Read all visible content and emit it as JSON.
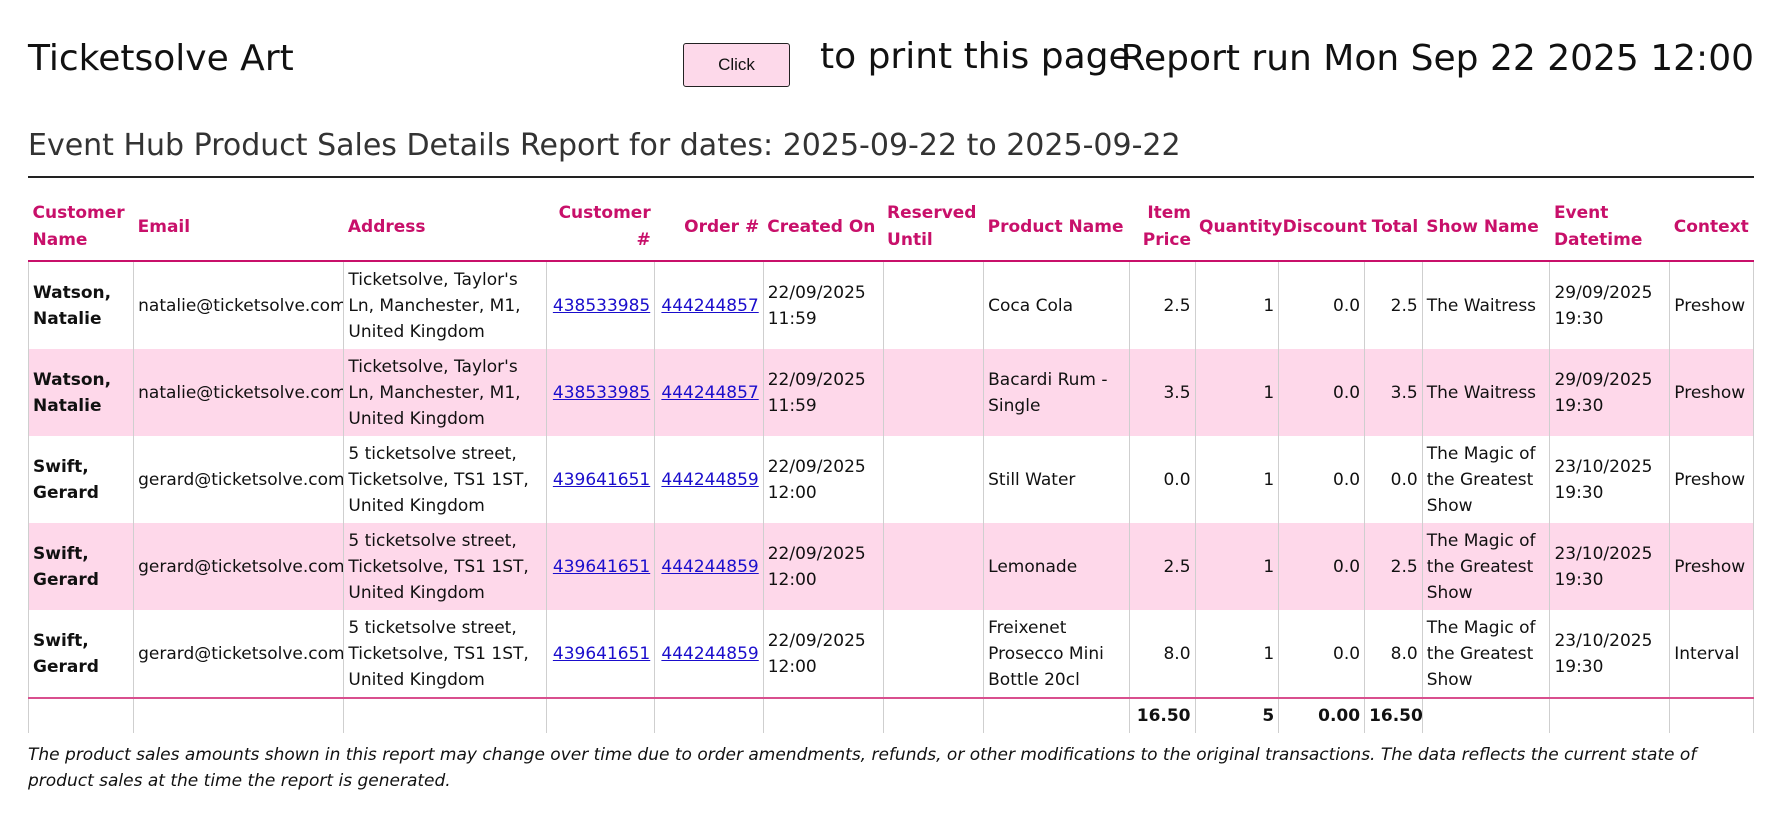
{
  "header": {
    "title": "Ticketsolve Art",
    "print_button_label": "Click",
    "print_text": "to print this page",
    "report_run": "Report run Mon Sep 22 2025 12:00"
  },
  "report": {
    "subtitle": "Event Hub Product Sales Details Report for dates: 2025-09-22 to 2025-09-22"
  },
  "table": {
    "headers": {
      "customer_name": "Customer Name",
      "email": "Email",
      "address": "Address",
      "customer_no": "Customer #",
      "order_no": "Order #",
      "created_on": "Created On",
      "reserved_until": "Reserved Until",
      "product_name": "Product Name",
      "item_price": "Item Price",
      "quantity": "Quantity",
      "discount": "Discount",
      "total": "Total",
      "show_name": "Show Name",
      "event_datetime": "Event Datetime",
      "context": "Context"
    },
    "rows": [
      {
        "customer_name": "Watson, Natalie",
        "email": "natalie@ticketsolve.com",
        "address": "Ticketsolve, Taylor's Ln, Manchester, M1, United Kingdom",
        "customer_no": "438533985",
        "order_no": "444244857",
        "created_on": "22/09/2025 11:59",
        "reserved_until": "",
        "product_name": "Coca Cola",
        "item_price": "2.5",
        "quantity": "1",
        "discount": "0.0",
        "total": "2.5",
        "show_name": "The Waitress",
        "event_datetime": "29/09/2025 19:30",
        "context": "Preshow"
      },
      {
        "customer_name": "Watson, Natalie",
        "email": "natalie@ticketsolve.com",
        "address": "Ticketsolve, Taylor's Ln, Manchester, M1, United Kingdom",
        "customer_no": "438533985",
        "order_no": "444244857",
        "created_on": "22/09/2025 11:59",
        "reserved_until": "",
        "product_name": "Bacardi Rum - Single",
        "item_price": "3.5",
        "quantity": "1",
        "discount": "0.0",
        "total": "3.5",
        "show_name": "The Waitress",
        "event_datetime": "29/09/2025 19:30",
        "context": "Preshow"
      },
      {
        "customer_name": "Swift, Gerard",
        "email": "gerard@ticketsolve.com",
        "address": "5 ticketsolve street, Ticketsolve, TS1 1ST, United Kingdom",
        "customer_no": "439641651",
        "order_no": "444244859",
        "created_on": "22/09/2025 12:00",
        "reserved_until": "",
        "product_name": "Still Water",
        "item_price": "0.0",
        "quantity": "1",
        "discount": "0.0",
        "total": "0.0",
        "show_name": "The Magic of the Greatest Show",
        "event_datetime": "23/10/2025 19:30",
        "context": "Preshow"
      },
      {
        "customer_name": "Swift, Gerard",
        "email": "gerard@ticketsolve.com",
        "address": "5 ticketsolve street, Ticketsolve, TS1 1ST, United Kingdom",
        "customer_no": "439641651",
        "order_no": "444244859",
        "created_on": "22/09/2025 12:00",
        "reserved_until": "",
        "product_name": "Lemonade",
        "item_price": "2.5",
        "quantity": "1",
        "discount": "0.0",
        "total": "2.5",
        "show_name": "The Magic of the Greatest Show",
        "event_datetime": "23/10/2025 19:30",
        "context": "Preshow"
      },
      {
        "customer_name": "Swift, Gerard",
        "email": "gerard@ticketsolve.com",
        "address": "5 ticketsolve street, Ticketsolve, TS1 1ST, United Kingdom",
        "customer_no": "439641651",
        "order_no": "444244859",
        "created_on": "22/09/2025 12:00",
        "reserved_until": "",
        "product_name": "Freixenet Prosecco Mini Bottle 20cl",
        "item_price": "8.0",
        "quantity": "1",
        "discount": "0.0",
        "total": "8.0",
        "show_name": "The Magic of the Greatest Show",
        "event_datetime": "23/10/2025 19:30",
        "context": "Interval"
      }
    ],
    "totals": {
      "item_price": "16.50",
      "quantity": "5",
      "discount": "0.00",
      "total": "16.50"
    }
  },
  "footer": {
    "note": "The product sales amounts shown in this report may change over time due to order amendments, refunds, or other modifications to the original transactions. The data reflects the current state of product sales at the time the report is generated."
  },
  "colors": {
    "accent": "#c8106a",
    "row_highlight": "#fed8ea",
    "link": "#1a0dcc",
    "button_bg": "#fdd9ea"
  }
}
